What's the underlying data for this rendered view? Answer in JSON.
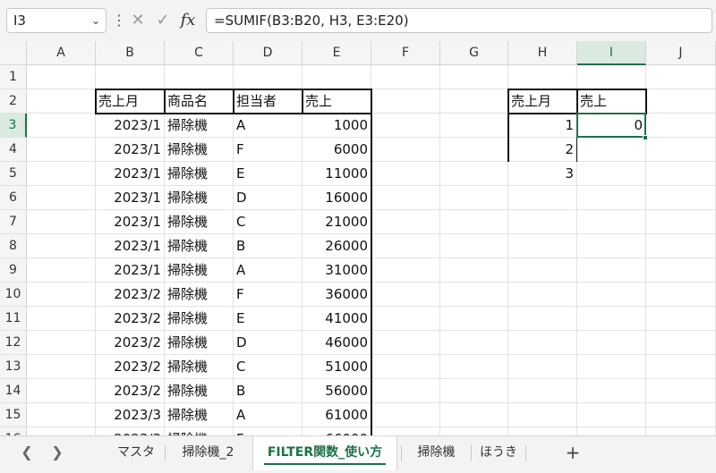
{
  "formula_bar": {
    "name_box": "I3",
    "formula": "=SUMIF(B3:B20, H3, E3:E20)"
  },
  "columns": [
    "A",
    "B",
    "C",
    "D",
    "E",
    "F",
    "G",
    "H",
    "I",
    "J"
  ],
  "rows": [
    "1",
    "2",
    "3",
    "4",
    "5",
    "6",
    "7",
    "8",
    "9",
    "10",
    "11",
    "12",
    "13",
    "14",
    "15",
    "16"
  ],
  "sales_table": {
    "headers": [
      "売上月",
      "商品名",
      "担当者",
      "売上"
    ],
    "rows": [
      [
        "2023/1",
        "掃除機",
        "A",
        "1000"
      ],
      [
        "2023/1",
        "掃除機",
        "F",
        "6000"
      ],
      [
        "2023/1",
        "掃除機",
        "E",
        "11000"
      ],
      [
        "2023/1",
        "掃除機",
        "D",
        "16000"
      ],
      [
        "2023/1",
        "掃除機",
        "C",
        "21000"
      ],
      [
        "2023/1",
        "掃除機",
        "B",
        "26000"
      ],
      [
        "2023/1",
        "掃除機",
        "A",
        "31000"
      ],
      [
        "2023/2",
        "掃除機",
        "F",
        "36000"
      ],
      [
        "2023/2",
        "掃除機",
        "E",
        "41000"
      ],
      [
        "2023/2",
        "掃除機",
        "D",
        "46000"
      ],
      [
        "2023/2",
        "掃除機",
        "C",
        "51000"
      ],
      [
        "2023/2",
        "掃除機",
        "B",
        "56000"
      ],
      [
        "2023/3",
        "掃除機",
        "A",
        "61000"
      ],
      [
        "2023/3",
        "掃除機",
        "F",
        "66000"
      ]
    ]
  },
  "summary_table": {
    "headers": [
      "売上月",
      "売上"
    ],
    "months": [
      "1",
      "2",
      "3"
    ],
    "values": [
      "0",
      "",
      ""
    ]
  },
  "sheet_tabs": [
    "マスタ",
    "掃除機_2",
    "FILTER関数_使い方",
    "掃除機",
    "ほうき"
  ],
  "active_tab_index": 2,
  "colors": {
    "accent": "#1e7145",
    "header_bg": "#f5f5f5",
    "selected_header_bg": "#dbeadf"
  }
}
